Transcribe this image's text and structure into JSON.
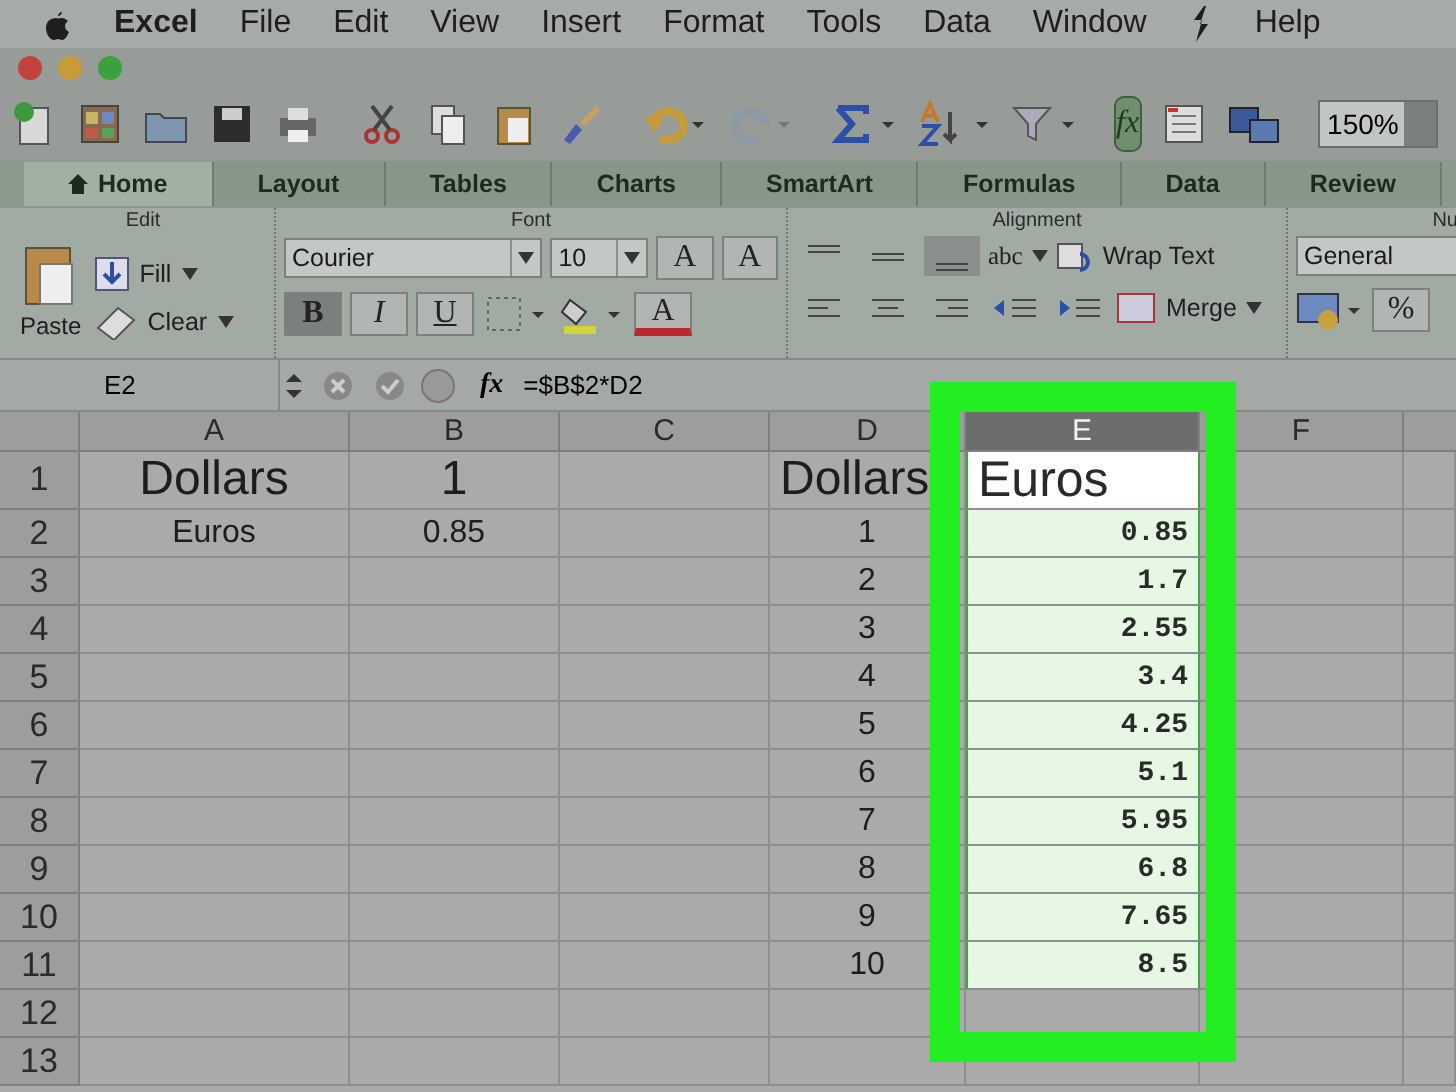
{
  "menu_bar": {
    "app": "Excel",
    "items": [
      "File",
      "Edit",
      "View",
      "Insert",
      "Format",
      "Tools",
      "Data",
      "Window",
      "Help"
    ]
  },
  "toolbar": {
    "function_button": "fx",
    "function_active": true,
    "zoom": "150%"
  },
  "tabs": [
    {
      "label": "Home",
      "selected": true
    },
    {
      "label": "Layout",
      "selected": false
    },
    {
      "label": "Tables",
      "selected": false
    },
    {
      "label": "Charts",
      "selected": false
    },
    {
      "label": "SmartArt",
      "selected": false
    },
    {
      "label": "Formulas",
      "selected": false
    },
    {
      "label": "Data",
      "selected": false
    },
    {
      "label": "Review",
      "selected": false
    }
  ],
  "ribbon": {
    "edit": {
      "label": "Edit",
      "paste": "Paste",
      "fill": "Fill",
      "clear": "Clear"
    },
    "font": {
      "label": "Font",
      "font_name": "Courier",
      "font_size": "10",
      "grow": "A",
      "shrink": "A",
      "bold_label": "B",
      "italic_label": "I",
      "underline_label": "U",
      "bold": true,
      "italic": false,
      "underline": false,
      "font_color_label": "A"
    },
    "alignment": {
      "label": "Alignment",
      "abc": "abc",
      "wrap_text": "Wrap Text",
      "merge": "Merge"
    },
    "number": {
      "label": "Nu",
      "format": "General",
      "percent": "%"
    }
  },
  "formula_bar": {
    "name_box": "E2",
    "fx": "fx",
    "formula": "=$B$2*D2"
  },
  "sheet": {
    "columns": [
      {
        "label": "A",
        "selected": false
      },
      {
        "label": "B",
        "selected": false
      },
      {
        "label": "C",
        "selected": false
      },
      {
        "label": "D",
        "selected": false
      },
      {
        "label": "E",
        "selected": true
      },
      {
        "label": "F",
        "selected": false
      }
    ],
    "rows": [
      {
        "number": "1",
        "kind": "title",
        "cells": [
          "Dollars",
          "1",
          null,
          "Dollars",
          "Euros",
          null
        ]
      },
      {
        "number": "2",
        "kind": "data",
        "cells": [
          "Euros",
          "0.85",
          null,
          "1",
          "0.85",
          null
        ]
      },
      {
        "number": "3",
        "kind": "data",
        "cells": [
          null,
          null,
          null,
          "2",
          "1.7",
          null
        ]
      },
      {
        "number": "4",
        "kind": "data",
        "cells": [
          null,
          null,
          null,
          "3",
          "2.55",
          null
        ]
      },
      {
        "number": "5",
        "kind": "data",
        "cells": [
          null,
          null,
          null,
          "4",
          "3.4",
          null
        ]
      },
      {
        "number": "6",
        "kind": "data",
        "cells": [
          null,
          null,
          null,
          "5",
          "4.25",
          null
        ]
      },
      {
        "number": "7",
        "kind": "data",
        "cells": [
          null,
          null,
          null,
          "6",
          "5.1",
          null
        ]
      },
      {
        "number": "8",
        "kind": "data",
        "cells": [
          null,
          null,
          null,
          "7",
          "5.95",
          null
        ]
      },
      {
        "number": "9",
        "kind": "data",
        "cells": [
          null,
          null,
          null,
          "8",
          "6.8",
          null
        ]
      },
      {
        "number": "10",
        "kind": "data",
        "cells": [
          null,
          null,
          null,
          "9",
          "7.65",
          null
        ]
      },
      {
        "number": "11",
        "kind": "data",
        "cells": [
          null,
          null,
          null,
          "10",
          "8.5",
          null
        ]
      },
      {
        "number": "12",
        "kind": "data",
        "cells": [
          null,
          null,
          null,
          null,
          null,
          null
        ]
      },
      {
        "number": "13",
        "kind": "data",
        "cells": [
          null,
          null,
          null,
          null,
          null,
          null
        ]
      }
    ]
  }
}
